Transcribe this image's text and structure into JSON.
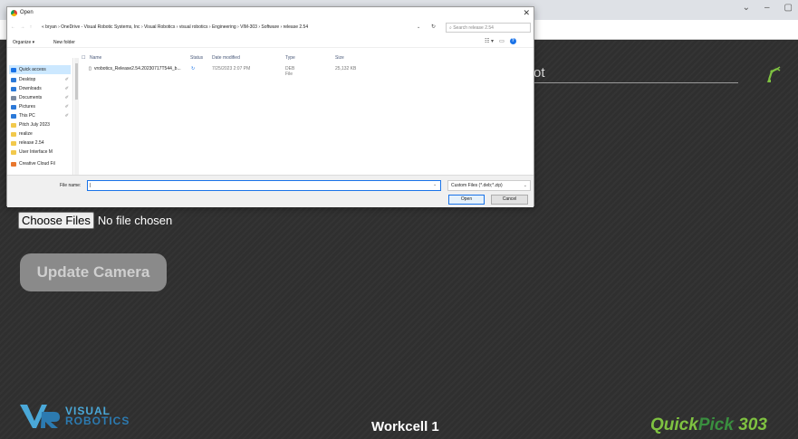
{
  "browser": {
    "window_controls": [
      "⌄",
      "–",
      "▢"
    ],
    "extension_icons": [
      "share-icon",
      "star-icon",
      "opera-icon",
      "puzzle-icon",
      "sidebar-icon",
      "profile-icon"
    ]
  },
  "app": {
    "header_field_text": "ot",
    "choose_files_label": "Choose Files",
    "no_file_text": "No file chosen",
    "update_camera_label": "Update Camera",
    "logo_line1": "VISUAL",
    "logo_line2": "ROBOTICS",
    "workcell_label": "Workcell 1",
    "product_quick": "Quick",
    "product_pick": "Pick",
    "product_num": " 303",
    "colors": {
      "accent_green": "#7fc241",
      "dark_green": "#3a8f3f",
      "logo_blue": "#4aa8d8"
    }
  },
  "dialog": {
    "title": "Open",
    "close": "✕",
    "nav_buttons": "← → ↑",
    "breadcrumb": "« bryan › OneDrive - Visual Robotic Systems, Inc › Visual Robotics › visual robotics › Engineering › VIM-303 › Software › release 2.54",
    "search_placeholder": "Search release 2.54",
    "organize_label": "Organize ▾",
    "new_folder_label": "New folder",
    "nav_items": [
      {
        "label": "Quick access",
        "color": "#1a73e8"
      },
      {
        "label": "Desktop",
        "color": "#2b79d8"
      },
      {
        "label": "Downloads",
        "color": "#2b79d8"
      },
      {
        "label": "Documents",
        "color": "#7a8aa0"
      },
      {
        "label": "Pictures",
        "color": "#2b79d8"
      },
      {
        "label": "This PC",
        "color": "#2b79d8"
      },
      {
        "label": "Pitch July 2023",
        "color": "#f2c94c"
      },
      {
        "label": "realize",
        "color": "#f2c94c"
      },
      {
        "label": "release 2.54",
        "color": "#f2c94c"
      },
      {
        "label": "User Interface M",
        "color": "#f2c94c"
      },
      {
        "label": "Creative Cloud Fil",
        "color": "#e8772e"
      }
    ],
    "columns": [
      "Name",
      "Status",
      "Date modified",
      "Type",
      "Size"
    ],
    "files": [
      {
        "name": "vrobotics_Release2.54.20230717T544_b...",
        "status": "↻",
        "date": "7/25/2023 2:07 PM",
        "type": "DEB File",
        "size": "25,132 KB"
      }
    ],
    "file_name_label": "File name:",
    "file_type": "Custom Files (*.deb;*.zip)",
    "open_label": "Open",
    "cancel_label": "Cancel"
  }
}
